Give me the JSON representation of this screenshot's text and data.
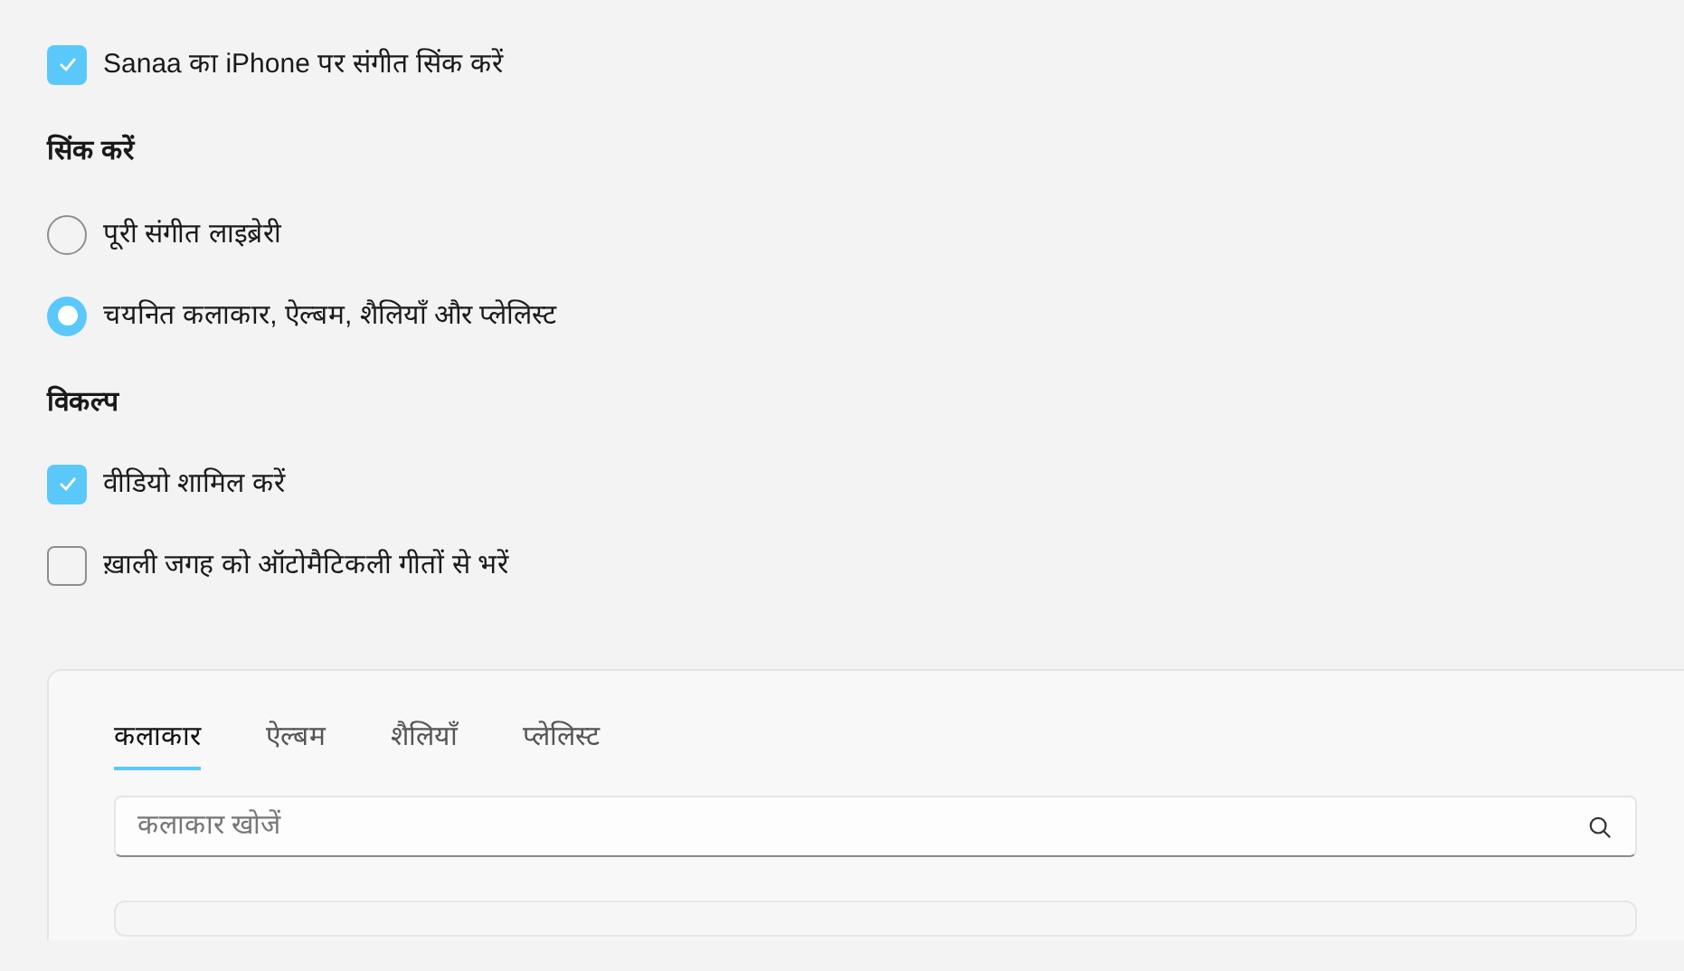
{
  "sync_checkbox": {
    "label": "Sanaa का iPhone पर संगीत सिंक करें",
    "checked": true
  },
  "sync_section": {
    "heading": "सिंक करें",
    "options": [
      {
        "label": "पूरी संगीत लाइब्रेरी",
        "selected": false
      },
      {
        "label": "चयनित कलाकार, ऐल्बम, शैलियाँ और प्लेलिस्ट",
        "selected": true
      }
    ]
  },
  "options_section": {
    "heading": "विकल्प",
    "checkboxes": [
      {
        "label": "वीडियो शामिल करें",
        "checked": true
      },
      {
        "label": "ख़ाली जगह को ऑटोमैटिकली गीतों से भरें",
        "checked": false
      }
    ]
  },
  "panel": {
    "tabs": [
      {
        "label": "कलाकार",
        "selected": true
      },
      {
        "label": "ऐल्बम",
        "selected": false
      },
      {
        "label": "शैलियाँ",
        "selected": false
      },
      {
        "label": "प्लेलिस्ट",
        "selected": false
      }
    ],
    "search": {
      "placeholder": "कलाकार खोजें"
    }
  }
}
